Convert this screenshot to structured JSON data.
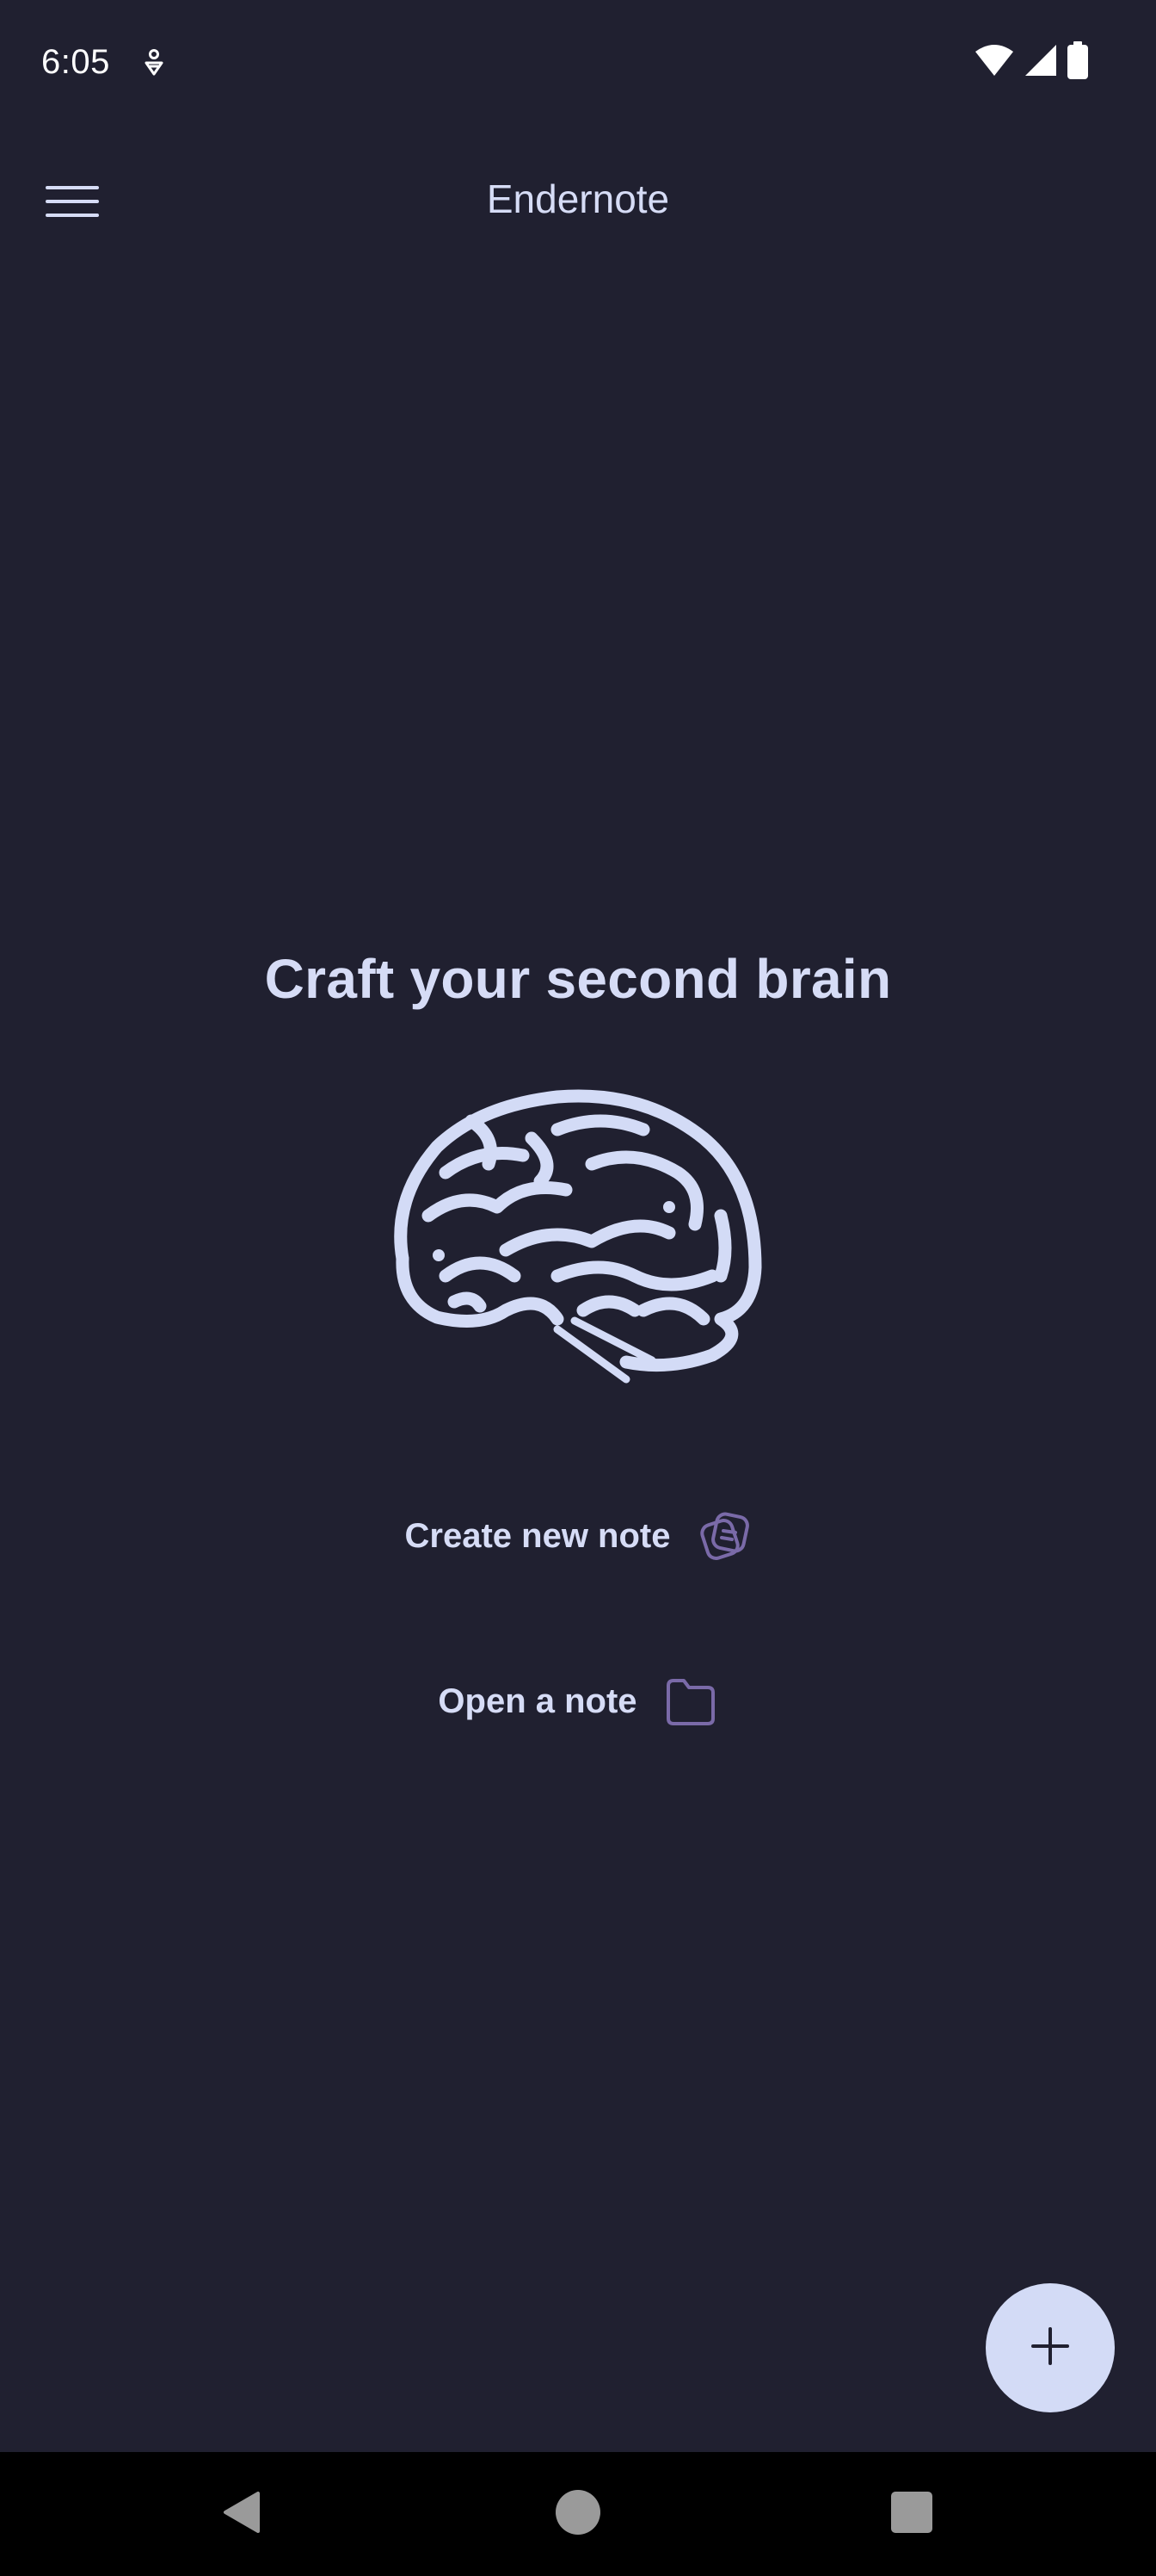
{
  "status_bar": {
    "time": "6:05",
    "icons": [
      "notification-icon",
      "wifi-icon",
      "signal-icon",
      "battery-icon"
    ]
  },
  "app_bar": {
    "title": "Endernote",
    "menu_icon": "hamburger-menu-icon"
  },
  "main": {
    "hero_title": "Craft your second brain",
    "illustration": "brain-icon",
    "actions": [
      {
        "label": "Create new note",
        "icon": "notes-icon"
      },
      {
        "label": "Open a note",
        "icon": "folder-icon"
      }
    ]
  },
  "fab": {
    "icon": "plus-icon"
  },
  "nav_bar": {
    "buttons": [
      "back-icon",
      "home-icon",
      "recents-icon"
    ]
  },
  "colors": {
    "background": "#202030",
    "text": "#d6dcf6",
    "fab": "#d3dbf6",
    "accent_icon": "#7a6aa8",
    "nav_bar": "#000000"
  }
}
